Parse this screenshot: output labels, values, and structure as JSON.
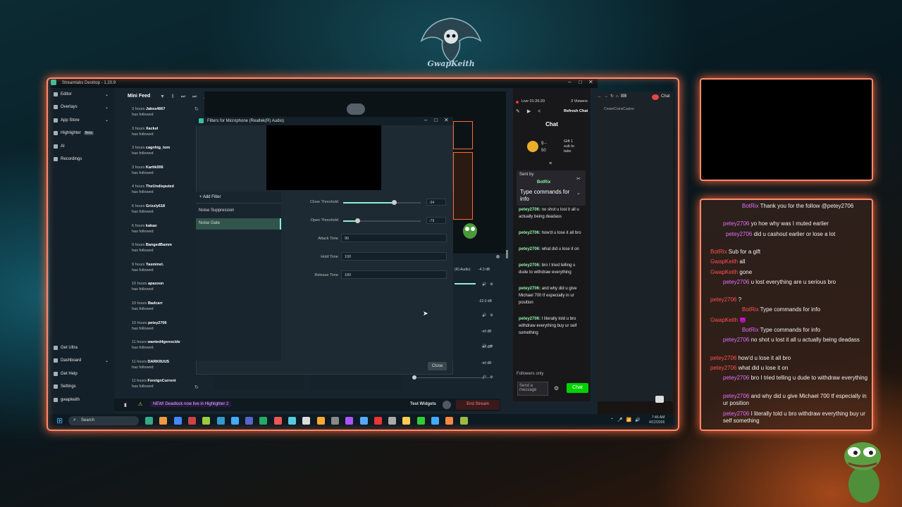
{
  "overlay": {
    "logo_text": "GwapKeith",
    "chat_messages": [
      {
        "user": "BotRix",
        "text": "Thank you for the follow @petey2706",
        "indent": 1,
        "color": "purple"
      },
      {
        "user": "petey2706",
        "text": "yo hoe why was I muted earlier",
        "indent": 2,
        "color": "purple"
      },
      {
        "user": "petey2706",
        "text": "did u cashout earlier or lose a lot",
        "indent": 3,
        "color": "purple"
      },
      {
        "user": "BotRix",
        "text": "Sub for a gift",
        "indent": 0,
        "color": "red"
      },
      {
        "user": "GwapKeith",
        "text": "all",
        "indent": 0,
        "color": "red"
      },
      {
        "user": "GwapKeith",
        "text": "gone",
        "indent": 0,
        "color": "red"
      },
      {
        "user": "petey2706",
        "text": "u lost everything are u serious bro",
        "indent": 2,
        "color": "purple"
      },
      {
        "user": "petey2706",
        "text": "?",
        "indent": 0,
        "color": "red"
      },
      {
        "user": "BotRix",
        "text": "Type commands for info",
        "indent": 1,
        "color": "red"
      },
      {
        "user": "GwapKeith",
        "text": "😈",
        "indent": 0,
        "color": "red"
      },
      {
        "user": "BotRix",
        "text": "Type commands for info",
        "indent": 1,
        "color": "purple"
      },
      {
        "user": "petey2706",
        "text": "no shot u lost it all u actually being deadass",
        "indent": 2,
        "color": "purple"
      },
      {
        "user": "petey2706",
        "text": "how'd u lose it all bro",
        "indent": 0,
        "color": "red"
      },
      {
        "user": "petey2706",
        "text": "what did u lose it on",
        "indent": 0,
        "color": "red"
      },
      {
        "user": "petey2706",
        "text": "bro I tried telling u dude to withdraw everything",
        "indent": 2,
        "color": "purple"
      },
      {
        "user": "petey2706",
        "text": "and why did u give Michael 700 tf especially in ur position",
        "indent": 2,
        "color": "purple"
      },
      {
        "user": "petey2706",
        "text": "I literally told u bro withdraw everything buy ur self something",
        "indent": 2,
        "color": "purple"
      }
    ]
  },
  "app": {
    "title": "Streamlabs Desktop - 1.20.9",
    "sidebar": [
      {
        "label": "Editor",
        "chev": true
      },
      {
        "label": "Overlays",
        "chev": true
      },
      {
        "label": "App Store",
        "chev": true
      },
      {
        "label": "Highlighter",
        "badge": "Beta"
      },
      {
        "label": "AI"
      },
      {
        "label": "Recordings"
      }
    ],
    "sidebar_bottom": [
      {
        "label": "Get Ultra"
      },
      {
        "label": "Dashboard",
        "chev": true
      },
      {
        "label": "Get Help"
      },
      {
        "label": "Settings"
      },
      {
        "label": "gwapkeith"
      }
    ],
    "mini_feed": {
      "title": "Mini Feed",
      "items": [
        {
          "time": "3 hours",
          "name": "Jakes4667",
          "action": "has followed"
        },
        {
          "time": "3 hours",
          "name": "Xackel",
          "action": "has followed"
        },
        {
          "time": "3 hours",
          "name": "cagnhig_tom",
          "action": "has followed"
        },
        {
          "time": "3 hours",
          "name": "Kartik006",
          "action": "has followed"
        },
        {
          "time": "4 hours",
          "name": "TheUndisputed",
          "action": "has followed"
        },
        {
          "time": "6 hours",
          "name": "Grizzly618",
          "action": "has followed"
        },
        {
          "time": "6 hours",
          "name": "kakao",
          "action": "has followed"
        },
        {
          "time": "9 hours",
          "name": "BangedBamm",
          "action": "has followed"
        },
        {
          "time": "9 hours",
          "name": "Yasminel.",
          "action": "has followed"
        },
        {
          "time": "10 hours",
          "name": "apazoon",
          "action": "has followed"
        },
        {
          "time": "10 hours",
          "name": "Badcarr",
          "action": "has followed"
        },
        {
          "time": "10 hours",
          "name": "petey2706",
          "action": "has followed"
        },
        {
          "time": "11 hours",
          "name": "wanted4genocide",
          "action": "has followed"
        },
        {
          "time": "11 hours",
          "name": "DARKIIUUS",
          "action": "has followed"
        },
        {
          "time": "11 hours",
          "name": "ForeignCurrent",
          "action": "has followed"
        },
        {
          "time": "11 hours",
          "name": "detroitcut",
          "action": ""
        }
      ]
    },
    "filters_dialog": {
      "title": "Filters for Microphone (Realtek(R) Audio)",
      "add_filter": "+ Add Filter",
      "filters": [
        "Noise Suppression",
        "Noise Gate"
      ],
      "selected_filter": "Noise Gate",
      "close_threshold": {
        "label": "Close Threshold",
        "value": "-34",
        "fraction": 0.65
      },
      "open_threshold": {
        "label": "Open Threshold",
        "value": "-79",
        "fraction": 0.18
      },
      "attack_time": {
        "label": "Attack Time",
        "value": "90"
      },
      "hold_time": {
        "label": "Hold Time",
        "value": "100"
      },
      "release_time": {
        "label": "Release Time",
        "value": "180"
      },
      "close_button": "Close"
    },
    "mixer": {
      "labels": [
        "(R) Audio)",
        "-4.3 dB",
        "-32.0 dB",
        "-inf dB",
        "-inf dB",
        "-inf dB"
      ]
    },
    "chat_panel": {
      "live_time": "Live 01:26:20",
      "viewers": "3 Viewers",
      "refresh": "Refresh Chat",
      "header": "Chat",
      "gift_text": "Gift 1 sub to take",
      "gift_count": "50",
      "gift_user": "g...",
      "pinned_label": "Sent by",
      "pinned_user": "BotRix",
      "pinned_text": "Type commands for info",
      "messages": [
        {
          "user": "petey2706:",
          "text": "no shot u lost it all u actually being deadass"
        },
        {
          "user": "petey2706:",
          "text": "how'd u lose it all bro"
        },
        {
          "user": "petey2706:",
          "text": "what did u lose it on"
        },
        {
          "user": "petey2706:",
          "text": "bro I tried telling u dude to withdraw everything"
        },
        {
          "user": "petey2706:",
          "text": "and why did u give Michael 700 tf especially in ur position"
        },
        {
          "user": "petey2706:",
          "text": "I literally told u bro withdraw everything buy ur self something"
        }
      ],
      "followers_only": "Followers only",
      "send_placeholder": "Send a message",
      "chat_button": "Chat"
    },
    "browser": {
      "tab": "Chat",
      "url_text": "CrownCoinsCasino"
    },
    "status_bar": {
      "news": "NEW! Deadlock now live in Highlighter 2",
      "test_widgets": "Test Widgets",
      "end_stream": "End Stream"
    }
  },
  "taskbar": {
    "search": "Search",
    "time": "7:46 AM",
    "date": "4/12/2026"
  },
  "colors": {
    "accent_green": "#80f5d2",
    "frame_orange": "#ff8a6a",
    "chat_green": "#00d200",
    "end_stream_red": "#e05050"
  }
}
